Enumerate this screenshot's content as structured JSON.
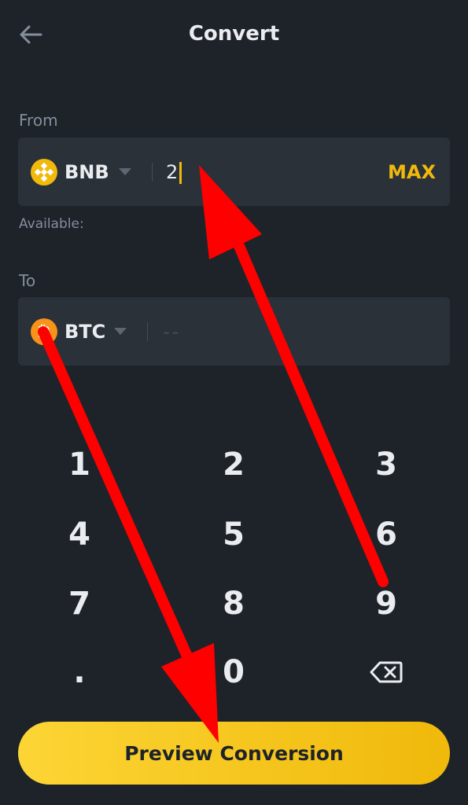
{
  "header": {
    "title": "Convert",
    "back_icon": "arrow-left-icon"
  },
  "from": {
    "label": "From",
    "coin": "BNB",
    "coin_icon": "bnb-coin-icon",
    "amount": "2",
    "max_label": "MAX",
    "available_label": "Available:"
  },
  "to": {
    "label": "To",
    "coin": "BTC",
    "coin_icon": "btc-coin-icon",
    "amount_placeholder": "--"
  },
  "keypad": {
    "keys": [
      "1",
      "2",
      "3",
      "4",
      "5",
      "6",
      "7",
      "8",
      "9",
      ".",
      "0"
    ],
    "backspace_icon": "backspace-icon"
  },
  "cta": {
    "label": "Preview Conversion"
  },
  "colors": {
    "background": "#1e2329",
    "field": "#2b3139",
    "accent": "#f0b90b",
    "annotation_arrow": "#ff0000"
  }
}
